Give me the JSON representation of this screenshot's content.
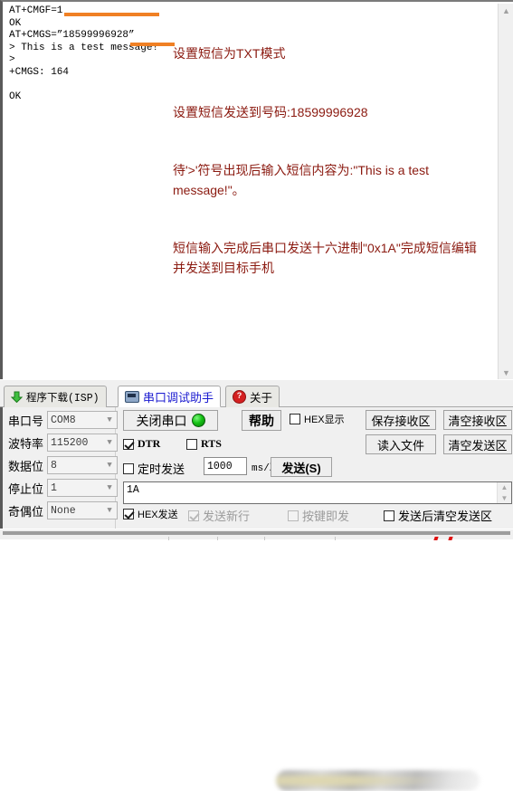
{
  "terminal": {
    "content": "AT+CMGF=1\nOK\nAT+CMGS=”18599996928”\n> This is a test message!\n>\n+CMGS: 164\n\nOK",
    "scrollbar_up_icon": "chevron-up-icon",
    "scrollbar_down_icon": "chevron-down-icon"
  },
  "annotations": {
    "color": "#8b1a10",
    "leader_color": "#f08024",
    "lines": [
      "设置短信为TXT模式",
      "设置短信发送到号码:18599996928",
      "待'>'符号出现后输入短信内容为:\"This is a test message!\"。",
      "短信输入完成后串口发送十六进制\"0x1A\"完成短信编辑并发送到目标手机"
    ]
  },
  "tabs": [
    {
      "label": "程序下载(ISP)",
      "icon": "download-arrow-icon",
      "active": false
    },
    {
      "label": "串口调试助手",
      "icon": "serial-plug-icon",
      "active": true
    },
    {
      "label": "关于",
      "icon": "question-mark-icon",
      "active": false
    }
  ],
  "settings": {
    "rows": [
      {
        "label": "串口号",
        "value": "COM8"
      },
      {
        "label": "波特率",
        "value": "115200"
      },
      {
        "label": "数据位",
        "value": "8"
      },
      {
        "label": "停止位",
        "value": "1"
      },
      {
        "label": "奇偶位",
        "value": "None"
      }
    ],
    "chevron_icon": "chevron-down-icon"
  },
  "controls": {
    "close_port_label": "关闭串口",
    "port_led": "#16c216",
    "help_label": "帮助",
    "dtr": {
      "label": "DTR",
      "checked": true,
      "disabled": false
    },
    "rts": {
      "label": "RTS",
      "checked": false,
      "disabled": false
    },
    "timed_send": {
      "label": "定时发送",
      "checked": false,
      "disabled": false
    },
    "interval_value": "1000",
    "interval_unit": "ms/次",
    "send_label": "发送(S)",
    "hex_display": {
      "label": "HEX显示",
      "checked": false,
      "disabled": false
    },
    "save_recv_label": "保存接收区",
    "clear_recv_label": "清空接收区",
    "read_file_label": "读入文件",
    "clear_send_label": "清空发送区"
  },
  "send_box": {
    "value": "1A",
    "scrollbar_up_icon": "chevron-up-icon",
    "scrollbar_down_icon": "chevron-down-icon"
  },
  "send_options": {
    "hex_send": {
      "label": "HEX发送",
      "checked": true,
      "disabled": false
    },
    "send_newline": {
      "label": "发送新行",
      "checked": true,
      "disabled": true
    },
    "key_send": {
      "label": "按键即发",
      "checked": false,
      "disabled": true
    },
    "clear_after_send": {
      "label": "发送后清空发送区",
      "checked": false,
      "disabled": false
    }
  }
}
